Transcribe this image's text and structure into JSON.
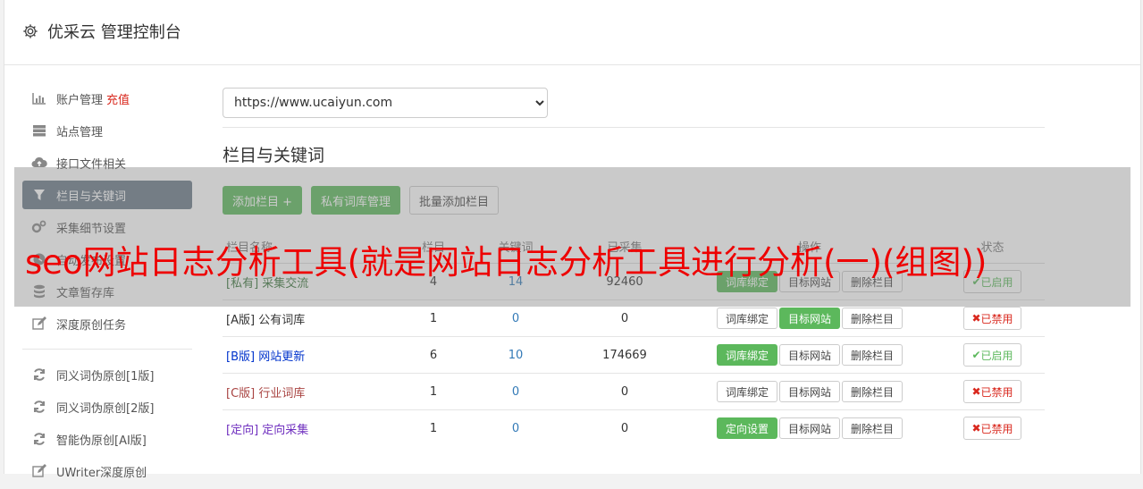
{
  "header": {
    "title": "优采云 管理控制台"
  },
  "sidebar": {
    "items": [
      {
        "label": "账户管理",
        "icon": "bar-chart-icon",
        "extra": "充值"
      },
      {
        "label": "站点管理",
        "icon": "server-icon"
      },
      {
        "label": "接口文件相关",
        "icon": "cloud-upload-icon"
      },
      {
        "label": "栏目与关键词",
        "icon": "filter-icon",
        "active": true
      },
      {
        "label": "采集细节设置",
        "icon": "gears-icon"
      },
      {
        "label": "自动发布设置",
        "icon": "clock-icon"
      },
      {
        "label": "文章暂存库",
        "icon": "database-icon"
      },
      {
        "label": "深度原创任务",
        "icon": "edit-icon"
      }
    ],
    "items2": [
      {
        "label": "同义词伪原创[1版]",
        "icon": "refresh-icon"
      },
      {
        "label": "同义词伪原创[2版]",
        "icon": "refresh-icon"
      },
      {
        "label": "智能伪原创[AI版]",
        "icon": "refresh-icon"
      },
      {
        "label": "UWriter深度原创",
        "icon": "edit-icon"
      }
    ]
  },
  "main": {
    "site_select": "https://www.ucaiyun.com",
    "section_title": "栏目与关键词",
    "buttons": {
      "add": "添加栏目 +",
      "private": "私有词库管理",
      "batch": "批量添加栏目"
    },
    "table": {
      "headers": [
        "栏目名称",
        "栏目",
        "关键词",
        "已采集",
        "操作",
        "状态"
      ],
      "rows": [
        {
          "tag": "[私有]",
          "name": "采集交流",
          "color": "green",
          "c1": "4",
          "c2": "14",
          "c3": "92460",
          "b1": "词库绑定",
          "b1on": true,
          "b2": "目标网站",
          "b2on": false,
          "b3": "删除栏目",
          "status": "已启用",
          "enabled": true
        },
        {
          "tag": "[A版]",
          "name": "公有词库",
          "color": "black",
          "c1": "1",
          "c2": "0",
          "c3": "0",
          "b1": "词库绑定",
          "b1on": false,
          "b2": "目标网站",
          "b2on": true,
          "b3": "删除栏目",
          "status": "已禁用",
          "enabled": false
        },
        {
          "tag": "[B版]",
          "name": "网站更新",
          "color": "blue",
          "c1": "6",
          "c2": "10",
          "c3": "174669",
          "b1": "词库绑定",
          "b1on": true,
          "b2": "目标网站",
          "b2on": false,
          "b3": "删除栏目",
          "status": "已启用",
          "enabled": true
        },
        {
          "tag": "[C版]",
          "name": "行业词库",
          "color": "red",
          "c1": "1",
          "c2": "0",
          "c3": "0",
          "b1": "词库绑定",
          "b1on": false,
          "b2": "目标网站",
          "b2on": false,
          "b3": "删除栏目",
          "status": "已禁用",
          "enabled": false
        },
        {
          "tag": "[定向]",
          "name": "定向采集",
          "color": "purple",
          "c1": "1",
          "c2": "0",
          "c3": "0",
          "b1": "定向设置",
          "b1on": true,
          "b2": "目标网站",
          "b2on": false,
          "b3": "删除栏目",
          "status": "已禁用",
          "enabled": false
        }
      ]
    }
  },
  "overlay": {
    "text": "seo网站日志分析工具(就是网站日志分析工具进行分析(一)(组图))"
  },
  "colors": {
    "accent_green": "#5cb85c",
    "active_bg": "#6c7a89",
    "danger": "#d9281e",
    "overlay_text": "#ee0000"
  }
}
